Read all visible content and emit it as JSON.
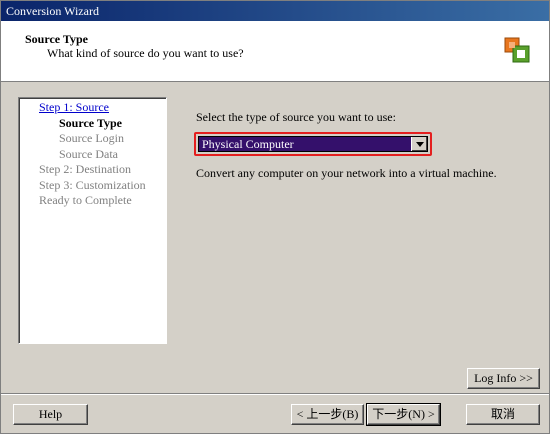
{
  "window": {
    "title": "Conversion Wizard"
  },
  "header": {
    "title": "Source Type",
    "subtitle": "What kind of source do you want to use?"
  },
  "steps": [
    {
      "label": "Step 1: Source",
      "state": "link"
    },
    {
      "label": "Source Type",
      "state": "current"
    },
    {
      "label": "Source Login",
      "state": "pending"
    },
    {
      "label": "Source Data",
      "state": "pending"
    },
    {
      "label": "Step 2: Destination",
      "state": "pending"
    },
    {
      "label": "Step 3: Customization",
      "state": "pending"
    },
    {
      "label": "Ready to Complete",
      "state": "pending"
    }
  ],
  "content": {
    "prompt": "Select the type of source you want to use:",
    "source_select": {
      "value": "Physical Computer"
    },
    "description": "Convert any computer on your network into a virtual machine."
  },
  "buttons": {
    "log_info": "Log Info >>",
    "help": "Help",
    "back": "< 上一步(B)",
    "next": "下一步(N) >",
    "cancel": "取消"
  },
  "colors": {
    "titlebar": "#0a246a",
    "highlight_border": "#e41f1f",
    "select_bg": "#34106b",
    "link": "#0000cc"
  }
}
